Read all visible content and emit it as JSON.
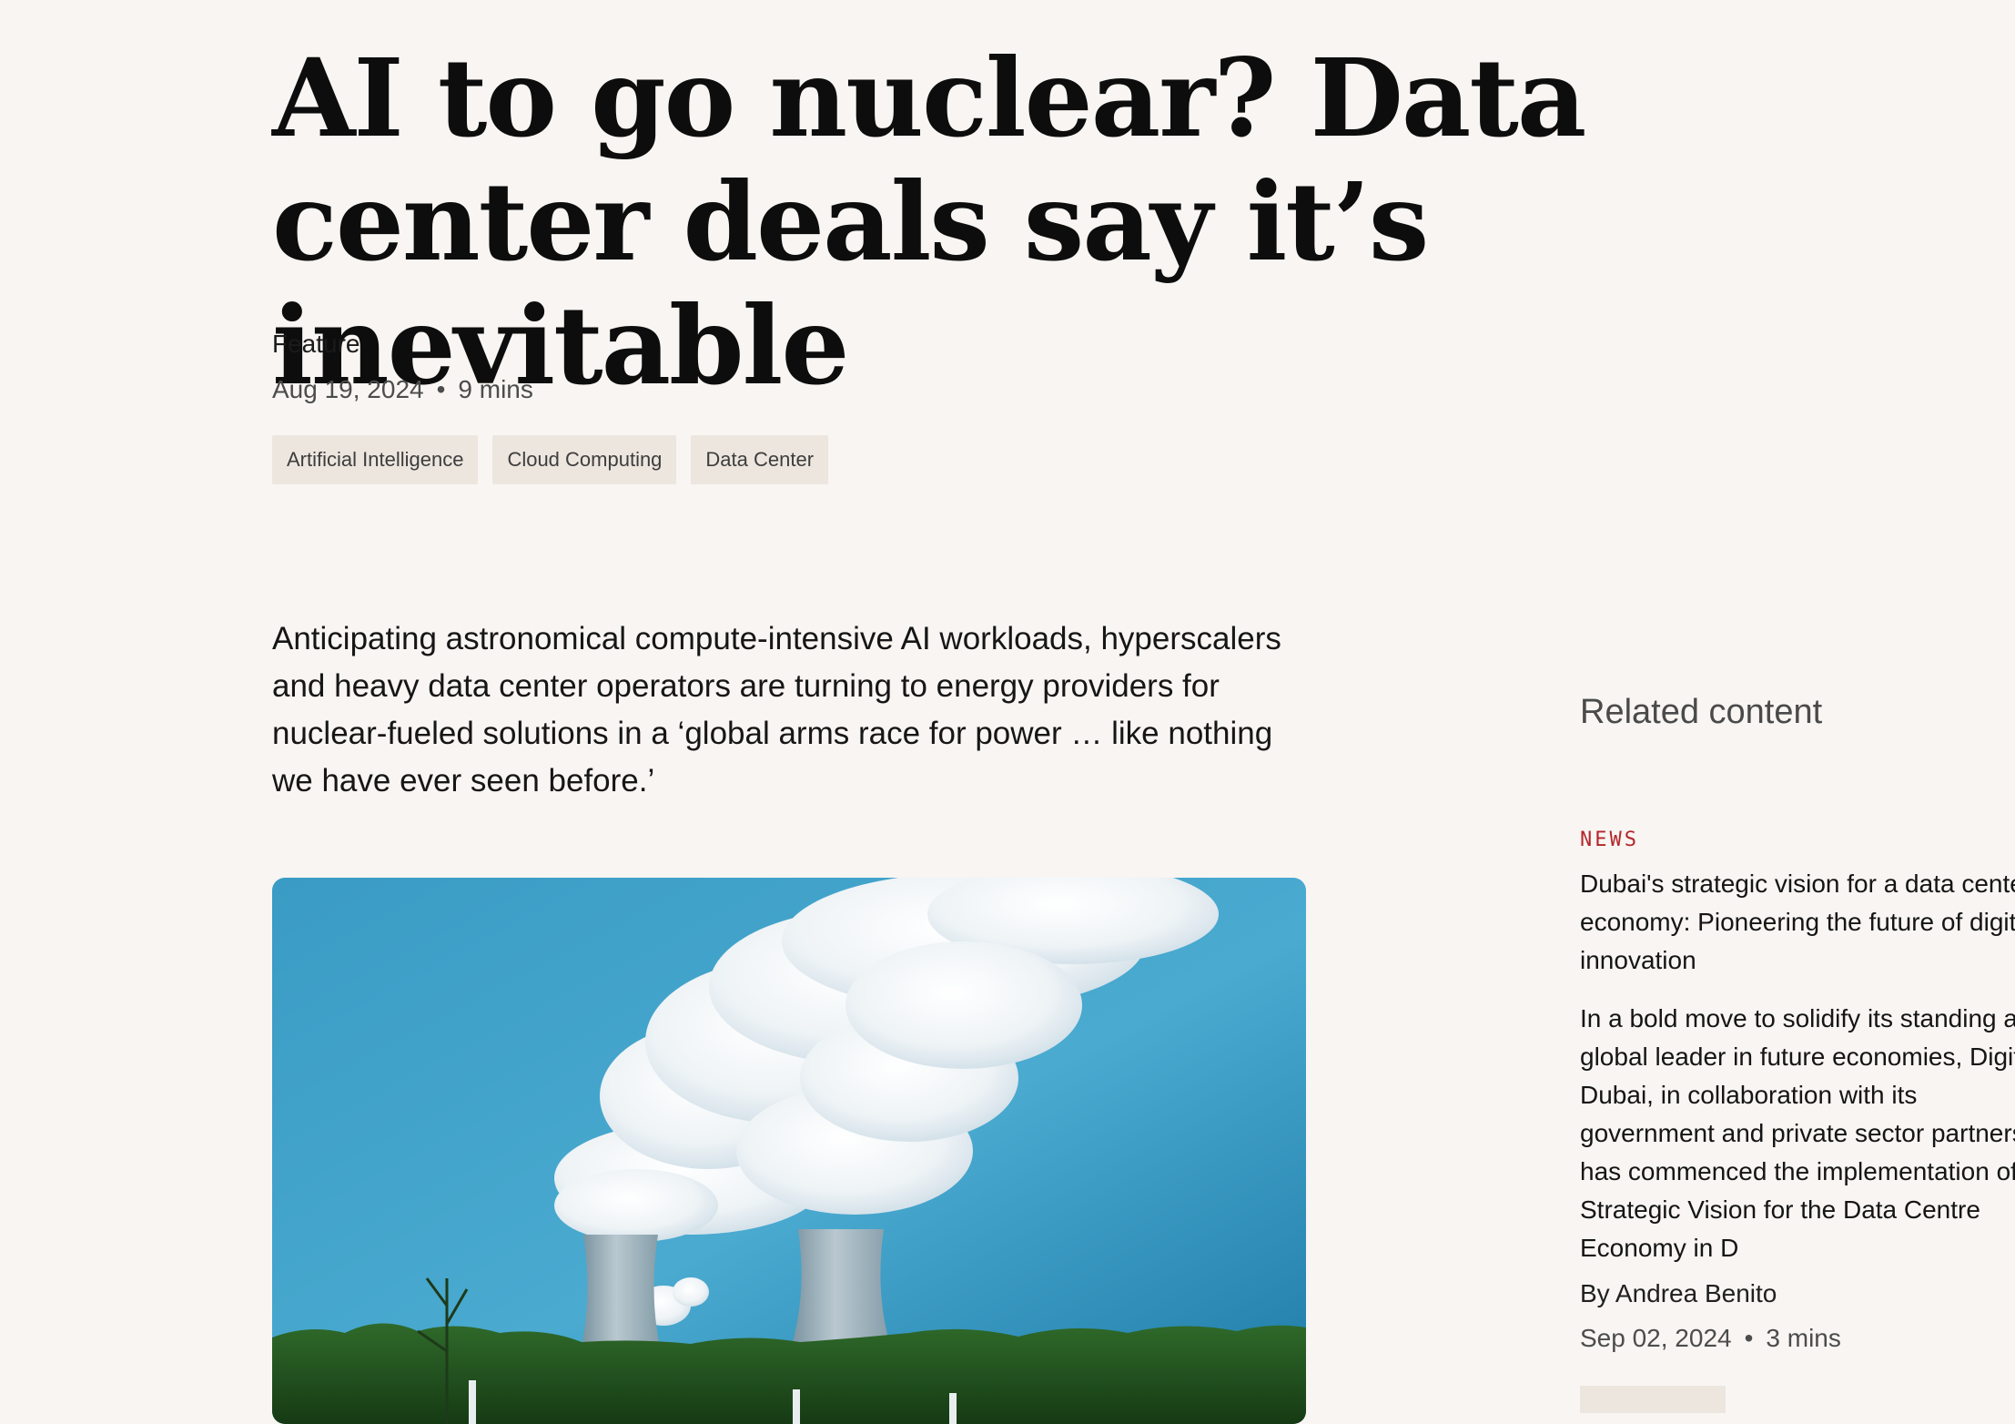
{
  "article": {
    "headline": "AI to go nuclear? Data center deals say it’s inevitable",
    "type": "Feature",
    "date": "Aug 19, 2024",
    "separator": "•",
    "read_time": "9 mins",
    "tags": [
      "Artificial Intelligence",
      "Cloud Computing",
      "Data Center"
    ],
    "dek": "Anticipating astronomical compute-intensive AI workloads, hyperscalers and heavy data center operators are turning to energy providers for nuclear-fueled solutions in a ‘global arms race for power … like nothing we have ever seen before.’",
    "hero_image": "nuclear cooling towers with steam plumes"
  },
  "related": {
    "title": "Related content",
    "card": {
      "category": "NEWS",
      "title": "Dubai's strategic vision for a data center economy: Pioneering the future of digital innovation",
      "summary": "In a bold move to solidify its standing as a global leader in future economies, Digital Dubai, in collaboration with its government and private sector partners, has commenced the implementation of its Strategic Vision for the Data Centre Economy in D",
      "author": "By Andrea Benito",
      "date": "Sep 02, 2024",
      "separator": "•",
      "read_time": "3 mins"
    }
  },
  "colors": {
    "background": "#f8f5f2",
    "tag_background": "#ede6df",
    "category_accent": "#b4262c"
  }
}
